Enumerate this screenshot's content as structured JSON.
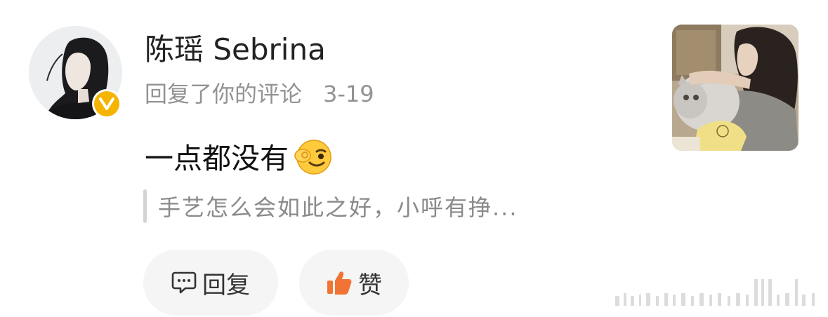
{
  "comment": {
    "username": "陈瑶 Sebrina",
    "action_text": "回复了你的评论",
    "date": "3-19",
    "text": "一点都没有",
    "emoji_icon": "wink-emoji-icon",
    "quoted_text": "手艺怎么会如此之好，小呼有挣..."
  },
  "actions": {
    "reply_label": "回复",
    "like_label": "赞"
  },
  "colors": {
    "verified_badge": "#F5B400",
    "like_icon": "#F27435",
    "meta_text": "#939393",
    "pill_bg": "#F5F5F5"
  }
}
